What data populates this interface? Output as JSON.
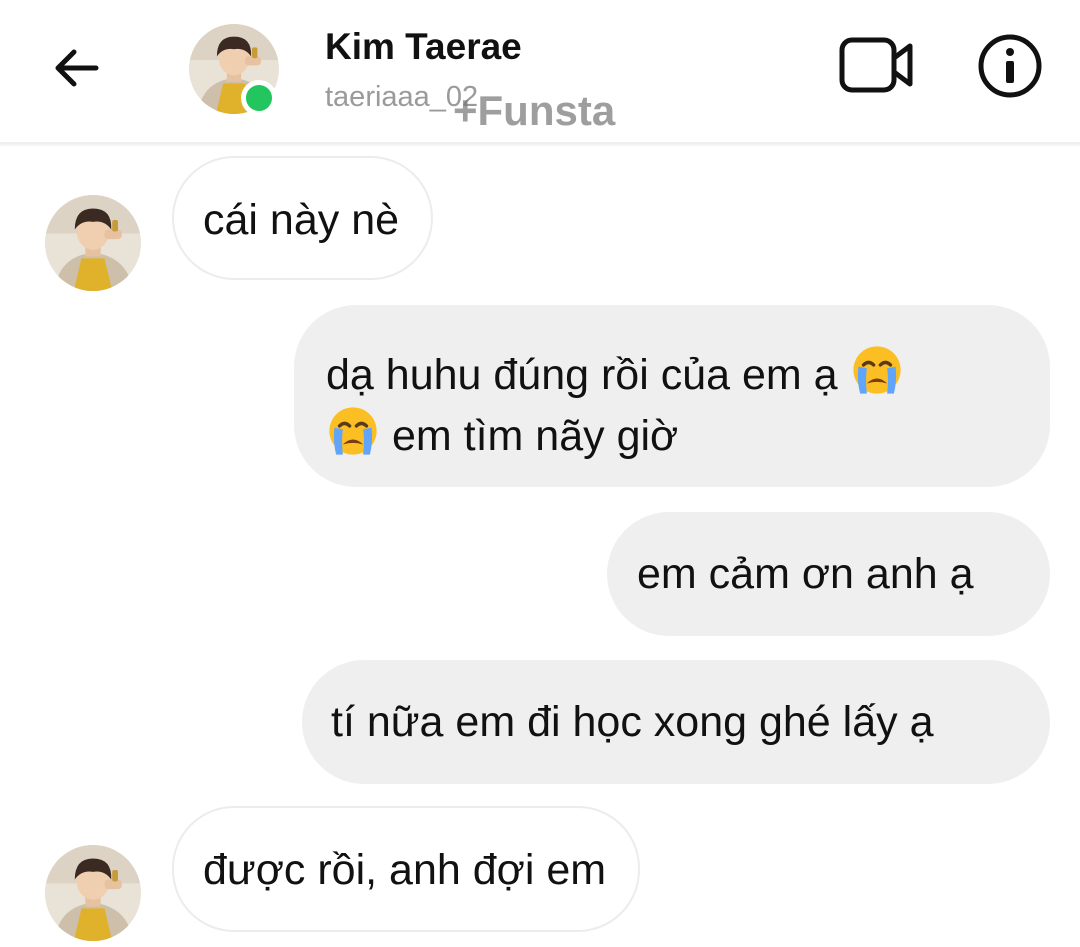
{
  "header": {
    "back_icon": "arrow-left-icon",
    "contact_name": "Kim Taerae",
    "contact_handle": "taeriaaa_02",
    "status": "online",
    "video_call_icon": "video-camera-icon",
    "info_icon": "info-icon"
  },
  "watermark": "+Funsta",
  "colors": {
    "online": "#22c55e",
    "incoming_bubble": "#ffffff",
    "outgoing_bubble": "#efefef",
    "handle_text": "#9a9a9a"
  },
  "messages": [
    {
      "direction": "incoming",
      "lines": [
        "cái này nè"
      ]
    },
    {
      "direction": "outgoing",
      "lines": [
        "dạ huhu đúng rồi của em ạ",
        "em tìm nãy giờ"
      ],
      "emojis": [
        "loudly-crying-face",
        "loudly-crying-face"
      ]
    },
    {
      "direction": "outgoing",
      "lines": [
        "em cảm ơn anh ạ"
      ]
    },
    {
      "direction": "outgoing",
      "lines": [
        "tí nữa em đi học xong ghé lấy ạ"
      ]
    },
    {
      "direction": "incoming",
      "lines": [
        "được rồi, anh đợi em"
      ]
    }
  ]
}
